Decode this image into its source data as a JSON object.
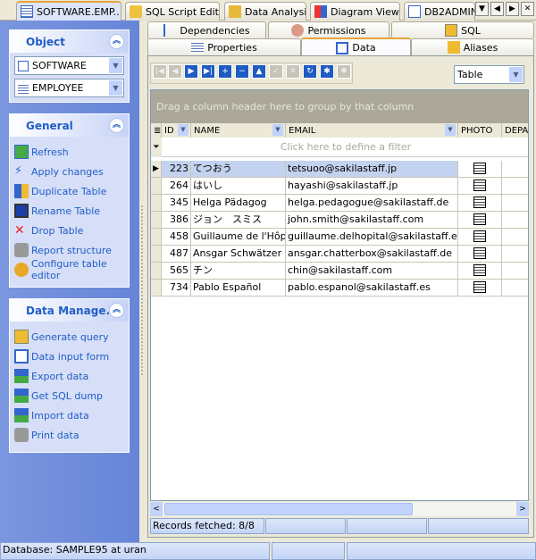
{
  "top_tabs": [
    {
      "label": "SOFTWARE.EMP...",
      "icon": "table-icon",
      "active": true
    },
    {
      "label": "SQL Script Editor",
      "icon": "sql-script-icon"
    },
    {
      "label": "Data Analysis",
      "icon": "cube-icon"
    },
    {
      "label": "Diagram Viewer",
      "icon": "chart-icon"
    },
    {
      "label": "DB2ADMIN",
      "icon": "schema-icon"
    }
  ],
  "sidebar": {
    "object": {
      "title": "Object",
      "schema": "SOFTWARE",
      "table": "EMPLOYEE"
    },
    "general": {
      "title": "General",
      "items": [
        {
          "label": "Refresh",
          "icon": "refresh-icon"
        },
        {
          "label": "Apply changes",
          "icon": "apply-icon"
        },
        {
          "label": "Duplicate Table",
          "icon": "duplicate-icon"
        },
        {
          "label": "Rename Table",
          "icon": "rename-icon"
        },
        {
          "label": "Drop Table",
          "icon": "drop-icon"
        },
        {
          "label": "Report structure",
          "icon": "printer-icon"
        },
        {
          "label": "Configure table editor",
          "icon": "configure-icon"
        }
      ]
    },
    "data_management": {
      "title": "Data Manage...",
      "items": [
        {
          "label": "Generate query",
          "icon": "query-icon"
        },
        {
          "label": "Data input form",
          "icon": "form-icon"
        },
        {
          "label": "Export data",
          "icon": "export-icon"
        },
        {
          "label": "Get SQL dump",
          "icon": "sql-dump-icon"
        },
        {
          "label": "Import data",
          "icon": "import-icon"
        },
        {
          "label": "Print data",
          "icon": "printer-icon"
        }
      ]
    }
  },
  "sub_tabs": {
    "row1": [
      "Dependencies",
      "Permissions",
      "SQL"
    ],
    "row2": [
      "Properties",
      "Data",
      "Aliases"
    ],
    "active": "Data"
  },
  "view_mode": "Table",
  "grid": {
    "group_hint": "Drag a column header here to group by that column",
    "filter_hint": "Click here to define a filter",
    "columns": [
      "ID",
      "NAME",
      "EMAIL",
      "PHOTO",
      "DEPAI"
    ],
    "rows": [
      {
        "id": "223",
        "name": "てつおう",
        "email": "tetsuoo@sakilastaff.jp"
      },
      {
        "id": "264",
        "name": "はいし",
        "email": "hayashi@sakilastaff.jp"
      },
      {
        "id": "345",
        "name": "Helga Pädagog",
        "email": "helga.pedagogue@sakilastaff.de"
      },
      {
        "id": "386",
        "name": "ジョン　スミス",
        "email": "john.smith@sakilastaff.com"
      },
      {
        "id": "458",
        "name": "Guillaume de l'Hôpital",
        "email": "guillaume.delhopital@sakilastaff.es"
      },
      {
        "id": "487",
        "name": "Ansgar Schwätzer",
        "email": "ansgar.chatterbox@sakilastaff.de"
      },
      {
        "id": "565",
        "name": "チン",
        "email": "chin@sakilastaff.com"
      },
      {
        "id": "734",
        "name": "Pablo Español",
        "email": "pablo.espanol@sakilastaff.es"
      }
    ],
    "selected_row": 0
  },
  "records_fetched": "Records fetched: 8/8",
  "status": "Database: SAMPLE95 at uran",
  "colors": {
    "sidebar": "#6f8edb",
    "link": "#215dc6",
    "selection": "#c3d3ef",
    "group_panel": "#aca899",
    "active_tab_accent": "#e6a43a"
  }
}
